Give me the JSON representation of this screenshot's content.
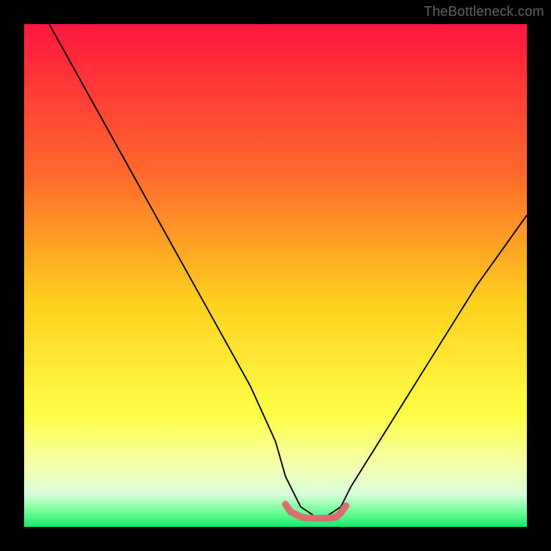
{
  "watermark": "TheBottleneck.com",
  "chart_data": {
    "type": "line",
    "title": "",
    "xlabel": "",
    "ylabel": "",
    "xlim": [
      0,
      100
    ],
    "ylim": [
      0,
      100
    ],
    "series": [
      {
        "name": "curve",
        "color": "#000000",
        "x": [
          5,
          10,
          15,
          20,
          25,
          30,
          35,
          40,
          45,
          50,
          52,
          55,
          58,
          60,
          63,
          65,
          70,
          75,
          80,
          85,
          90,
          95,
          100
        ],
        "y": [
          100,
          91,
          82,
          73,
          64,
          55,
          46,
          37,
          28,
          17,
          10,
          4,
          2,
          2,
          4,
          8,
          16,
          24,
          32,
          40,
          48,
          55,
          62
        ]
      },
      {
        "name": "highlight",
        "color": "#d6706e",
        "x": [
          52,
          53,
          55,
          56,
          58,
          60,
          62,
          63,
          64
        ],
        "y": [
          4.5,
          3.0,
          2.0,
          1.8,
          1.7,
          1.7,
          1.9,
          2.8,
          4.2
        ]
      }
    ],
    "background_gradient": [
      {
        "pos": 0.0,
        "color": "#ff173f"
      },
      {
        "pos": 0.3,
        "color": "#ff6a2c"
      },
      {
        "pos": 0.55,
        "color": "#ffcf1e"
      },
      {
        "pos": 0.78,
        "color": "#ffff47"
      },
      {
        "pos": 0.88,
        "color": "#f4ffb0"
      },
      {
        "pos": 0.935,
        "color": "#d8ffda"
      },
      {
        "pos": 0.965,
        "color": "#7dff9f"
      },
      {
        "pos": 1.0,
        "color": "#17e86b"
      }
    ]
  }
}
